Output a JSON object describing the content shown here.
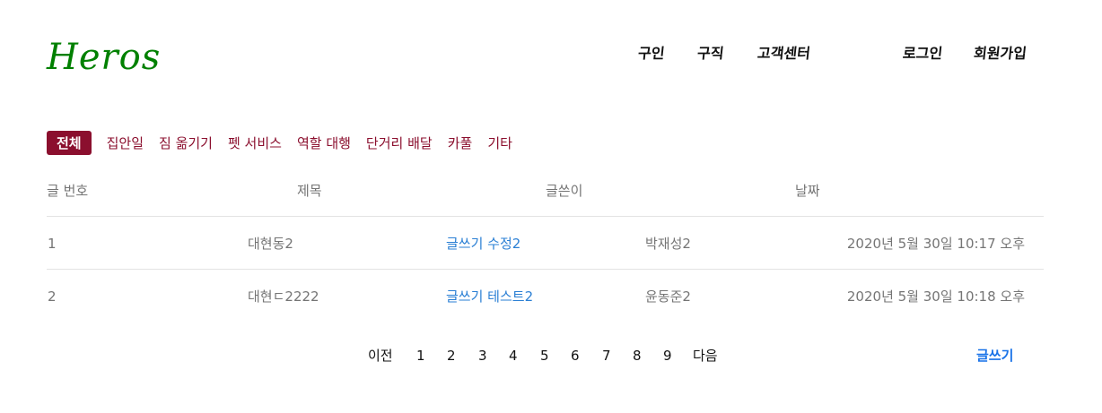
{
  "header": {
    "logo": "Heros",
    "nav": {
      "left": [
        "구인",
        "구직",
        "고객센터"
      ],
      "right": [
        "로그인",
        "회원가입"
      ]
    }
  },
  "categories": {
    "items": [
      "전체",
      "집안일",
      "짐 옮기기",
      "펫 서비스",
      "역할 대행",
      "단거리 배달",
      "카풀",
      "기타"
    ],
    "active": "전체"
  },
  "table": {
    "headers": [
      "글 번호",
      "제목",
      "글쓴이",
      "날짜"
    ],
    "rows": [
      {
        "no": "1",
        "category": "대현동2",
        "title": "글쓰기 수정2",
        "author": "박재성2",
        "date": "2020년 5월 30일 10:17 오후"
      },
      {
        "no": "2",
        "category": "대현ㄷ2222",
        "title": "글쓰기 테스트2",
        "author": "윤동준2",
        "date": "2020년 5월 30일 10:18 오후"
      }
    ]
  },
  "pagination": {
    "prev": "이전",
    "pages": [
      "1",
      "2",
      "3",
      "4",
      "5",
      "6",
      "7",
      "8",
      "9"
    ],
    "next": "다음"
  },
  "actions": {
    "write": "글쓰기"
  },
  "colors": {
    "logo": "#008000",
    "category_accent": "#8b0f2e",
    "link": "#2a7fd4",
    "write_button": "#1a73e8"
  }
}
